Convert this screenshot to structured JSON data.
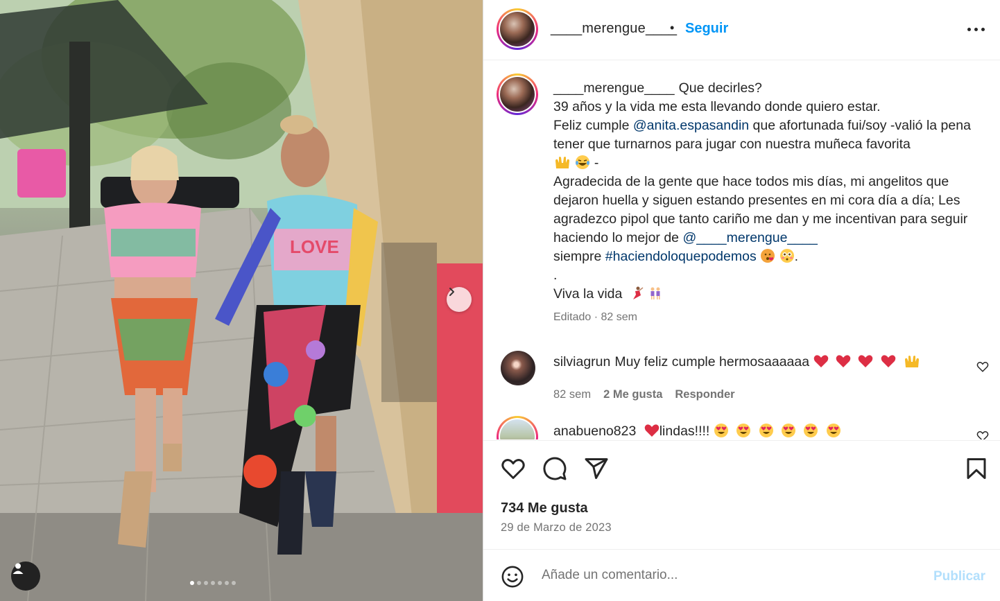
{
  "post": {
    "username": "____merengue____",
    "follow_label": "Seguir",
    "separator": "•"
  },
  "caption": {
    "username": "____merengue____",
    "line1": "Que decirles?",
    "line2": "39 años y la vida me esta llevando donde quiero estar.",
    "line3_pre": "Feliz cumple ",
    "line3_mention": "@anita.espasandin",
    "line3_post": " que afortunada fui/soy -valió la pena tener que turnarnos para jugar con nuestra muñeca favorita",
    "line4_pre": "Agradecida de la gente que hace todos mis días, mi angelitos que dejaron huella y siguen estando presentes en mi cora día a día; Les agradezco pipol que tanto cariño me dan y me incentivan para seguir haciendo lo mejor de ",
    "line4_mention": "@____merengue____",
    "line4_mid": "siempre ",
    "line4_tag": "#haciendoloquepodemos",
    "line4_end": ".",
    "dot_line": ".",
    "line5": "Viva la vida",
    "meta": "Editado · 82 sem"
  },
  "comments": [
    {
      "user": "silviagrun",
      "text": "Muy feliz cumple hermosaaaaaa",
      "time": "82 sem",
      "likes": "2 Me gusta",
      "reply": "Responder"
    },
    {
      "user": "anabueno823",
      "text": "lindas!!!!"
    }
  ],
  "actions": {
    "likes_count": "734 Me gusta",
    "date": "29 de Marzo de 2023"
  },
  "comment_box": {
    "placeholder": "Añade un comentario...",
    "publish_label": "Publicar"
  },
  "carousel": {
    "slide_count": 7,
    "active_index": 0
  },
  "colors": {
    "accent": "#0095f6",
    "link": "#00376b",
    "muted": "#737373",
    "publish_disabled": "#b2dffc",
    "heart": "#ed4956"
  },
  "icons": [
    "next-arrow-icon",
    "user-tag-icon",
    "more-options-icon",
    "like-icon",
    "comment-icon",
    "share-icon",
    "save-icon",
    "emoji-icon",
    "comment-like-icon"
  ]
}
